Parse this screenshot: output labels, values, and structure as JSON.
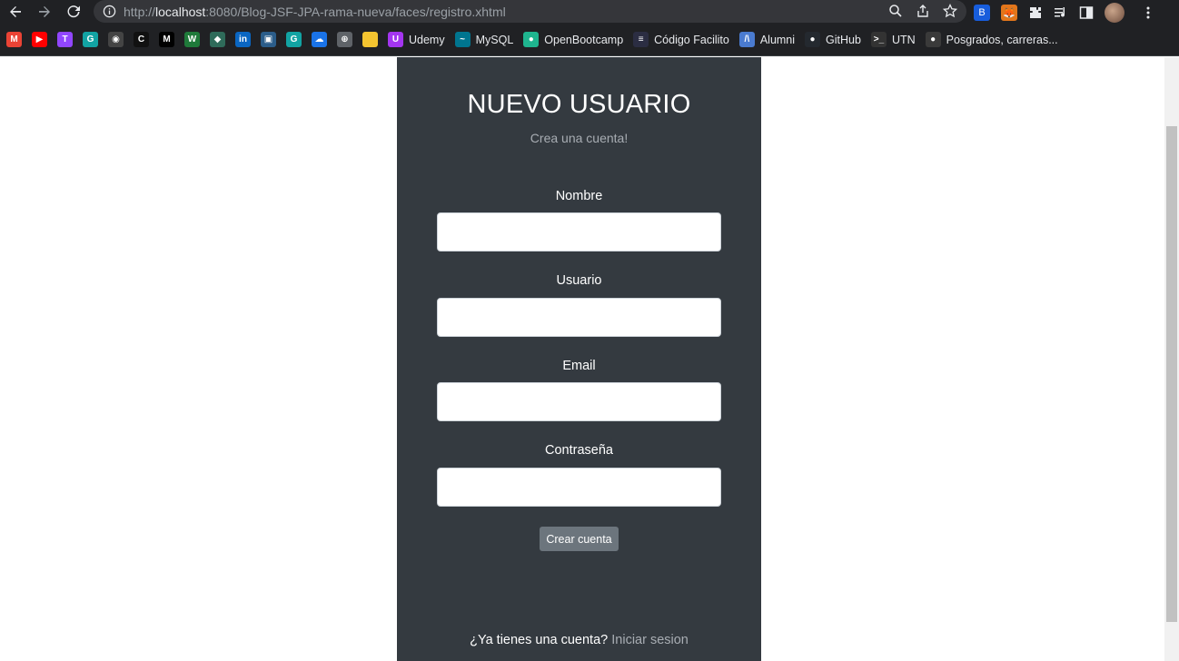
{
  "browser": {
    "url_prefix": "http://",
    "url_host": "localhost",
    "url_rest": ":8080/Blog-JSF-JPA-rama-nueva/faces/registro.xhtml"
  },
  "bookmarks": [
    {
      "icon": "gmail-icon",
      "label": "",
      "color": "#ea4335",
      "glyph": "M"
    },
    {
      "icon": "youtube-icon",
      "label": "",
      "color": "#ff0000",
      "glyph": "▶"
    },
    {
      "icon": "twitch-icon",
      "label": "",
      "color": "#9146ff",
      "glyph": "T"
    },
    {
      "icon": "replit-icon",
      "label": "",
      "color": "#12a3a3",
      "glyph": "G"
    },
    {
      "icon": "soccer-icon",
      "label": "",
      "color": "#444444",
      "glyph": "◉"
    },
    {
      "icon": "coder-icon",
      "label": "",
      "color": "#111111",
      "glyph": "C"
    },
    {
      "icon": "medium-icon",
      "label": "",
      "color": "#000000",
      "glyph": "M"
    },
    {
      "icon": "w-icon",
      "label": "",
      "color": "#1f7a3a",
      "glyph": "W"
    },
    {
      "icon": "ethereum-icon",
      "label": "",
      "color": "#2f6b5a",
      "glyph": "◆"
    },
    {
      "icon": "linkedin-icon",
      "label": "",
      "color": "#0a66c2",
      "glyph": "in"
    },
    {
      "icon": "picture-icon",
      "label": "",
      "color": "#2b5d8a",
      "glyph": "▣"
    },
    {
      "icon": "replit2-icon",
      "label": "",
      "color": "#12a3a3",
      "glyph": "G"
    },
    {
      "icon": "cloud-icon",
      "label": "",
      "color": "#1a73e8",
      "glyph": "☁"
    },
    {
      "icon": "globe-icon",
      "label": "",
      "color": "#5f6368",
      "glyph": "⊕"
    },
    {
      "icon": "note-icon",
      "label": "",
      "color": "#f4c430",
      "glyph": ""
    },
    {
      "icon": "udemy-icon",
      "label": "Udemy",
      "color": "#a435f0",
      "glyph": "U"
    },
    {
      "icon": "mysql-icon",
      "label": "MySQL",
      "color": "#00758f",
      "glyph": "~"
    },
    {
      "icon": "openbootcamp-icon",
      "label": "OpenBootcamp",
      "color": "#1fb58f",
      "glyph": "●"
    },
    {
      "icon": "codigofacilito-icon",
      "label": "Código Facilito",
      "color": "#2b2d42",
      "glyph": "≡"
    },
    {
      "icon": "alumni-icon",
      "label": "Alumni",
      "color": "#4a7bd0",
      "glyph": "/\\"
    },
    {
      "icon": "github-icon",
      "label": "GitHub",
      "color": "#24292f",
      "glyph": "●"
    },
    {
      "icon": "terminal-icon",
      "label": "UTN",
      "color": "#333333",
      "glyph": ">_"
    },
    {
      "icon": "posgrados-icon",
      "label": "Posgrados, carreras...",
      "color": "#3a3a3a",
      "glyph": "●"
    }
  ],
  "form": {
    "title": "NUEVO USUARIO",
    "subtitle": "Crea una cuenta!",
    "fields": [
      {
        "label": "Nombre",
        "value": ""
      },
      {
        "label": "Usuario",
        "value": ""
      },
      {
        "label": "Email",
        "value": ""
      },
      {
        "label": "Contraseña",
        "value": ""
      }
    ],
    "submit_label": "Crear cuenta",
    "footer_text": "¿Ya tienes una cuenta?",
    "footer_link": "Iniciar sesion"
  }
}
